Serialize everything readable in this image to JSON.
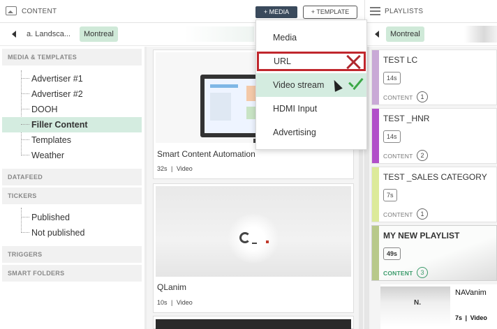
{
  "header": {
    "content_title": "CONTENT",
    "media_button": "+ MEDIA",
    "template_button": "+ TEMPLATE",
    "playlists_title": "PLAYLISTS"
  },
  "breadcrumb": {
    "crumb1": "a. Landsca...",
    "crumb2": "Montreal"
  },
  "playlists_breadcrumb": {
    "chip": "Montreal"
  },
  "sidebar": {
    "media_templates_heading": "MEDIA & TEMPLATES",
    "folders": [
      {
        "label": "Advertiser #1"
      },
      {
        "label": "Advertiser #2"
      },
      {
        "label": "DOOH"
      },
      {
        "label": "Filler Content",
        "selected": true
      },
      {
        "label": "Templates"
      },
      {
        "label": "Weather"
      }
    ],
    "datafeed_heading": "DATAFEED",
    "tickers_heading": "TICKERS",
    "tickers": [
      {
        "label": "Published"
      },
      {
        "label": "Not published"
      }
    ],
    "triggers_heading": "TRIGGERS",
    "smart_folders_heading": "SMART FOLDERS"
  },
  "content_cards": [
    {
      "name": "Smart Content Automation",
      "duration": "32s",
      "type": "Video"
    },
    {
      "name": "QLanim",
      "duration": "10s",
      "type": "Video"
    }
  ],
  "playlists": [
    {
      "title": "TEST LC",
      "duration": "14s",
      "content_label": "CONTENT",
      "count": "1",
      "stripe": "#c9a9d6"
    },
    {
      "title": "TEST _HNR",
      "duration": "14s",
      "content_label": "CONTENT",
      "count": "2",
      "stripe": "#b14fc9"
    },
    {
      "title": "TEST _SALES CATEGORY",
      "duration": "7s",
      "content_label": "CONTENT",
      "count": "1",
      "stripe": "#dcea9a"
    },
    {
      "title": "MY NEW PLAYLIST",
      "duration": "49s",
      "content_label": "CONTENT",
      "count": "3",
      "stripe": "#b8c98a",
      "active": true
    }
  ],
  "playlist_item": {
    "name": "NAVanim",
    "duration": "7s",
    "type": "Video",
    "logo": "N."
  },
  "media_menu": {
    "items": [
      "Media",
      "URL",
      "Video stream",
      "HDMI Input",
      "Advertising"
    ],
    "highlighted": "URL",
    "hovered": "Video stream"
  },
  "colors": {
    "accent_green": "#d4ece0",
    "media_button_bg": "#3a4a5c",
    "error_red": "#c0272d",
    "success_green": "#3aa845"
  }
}
